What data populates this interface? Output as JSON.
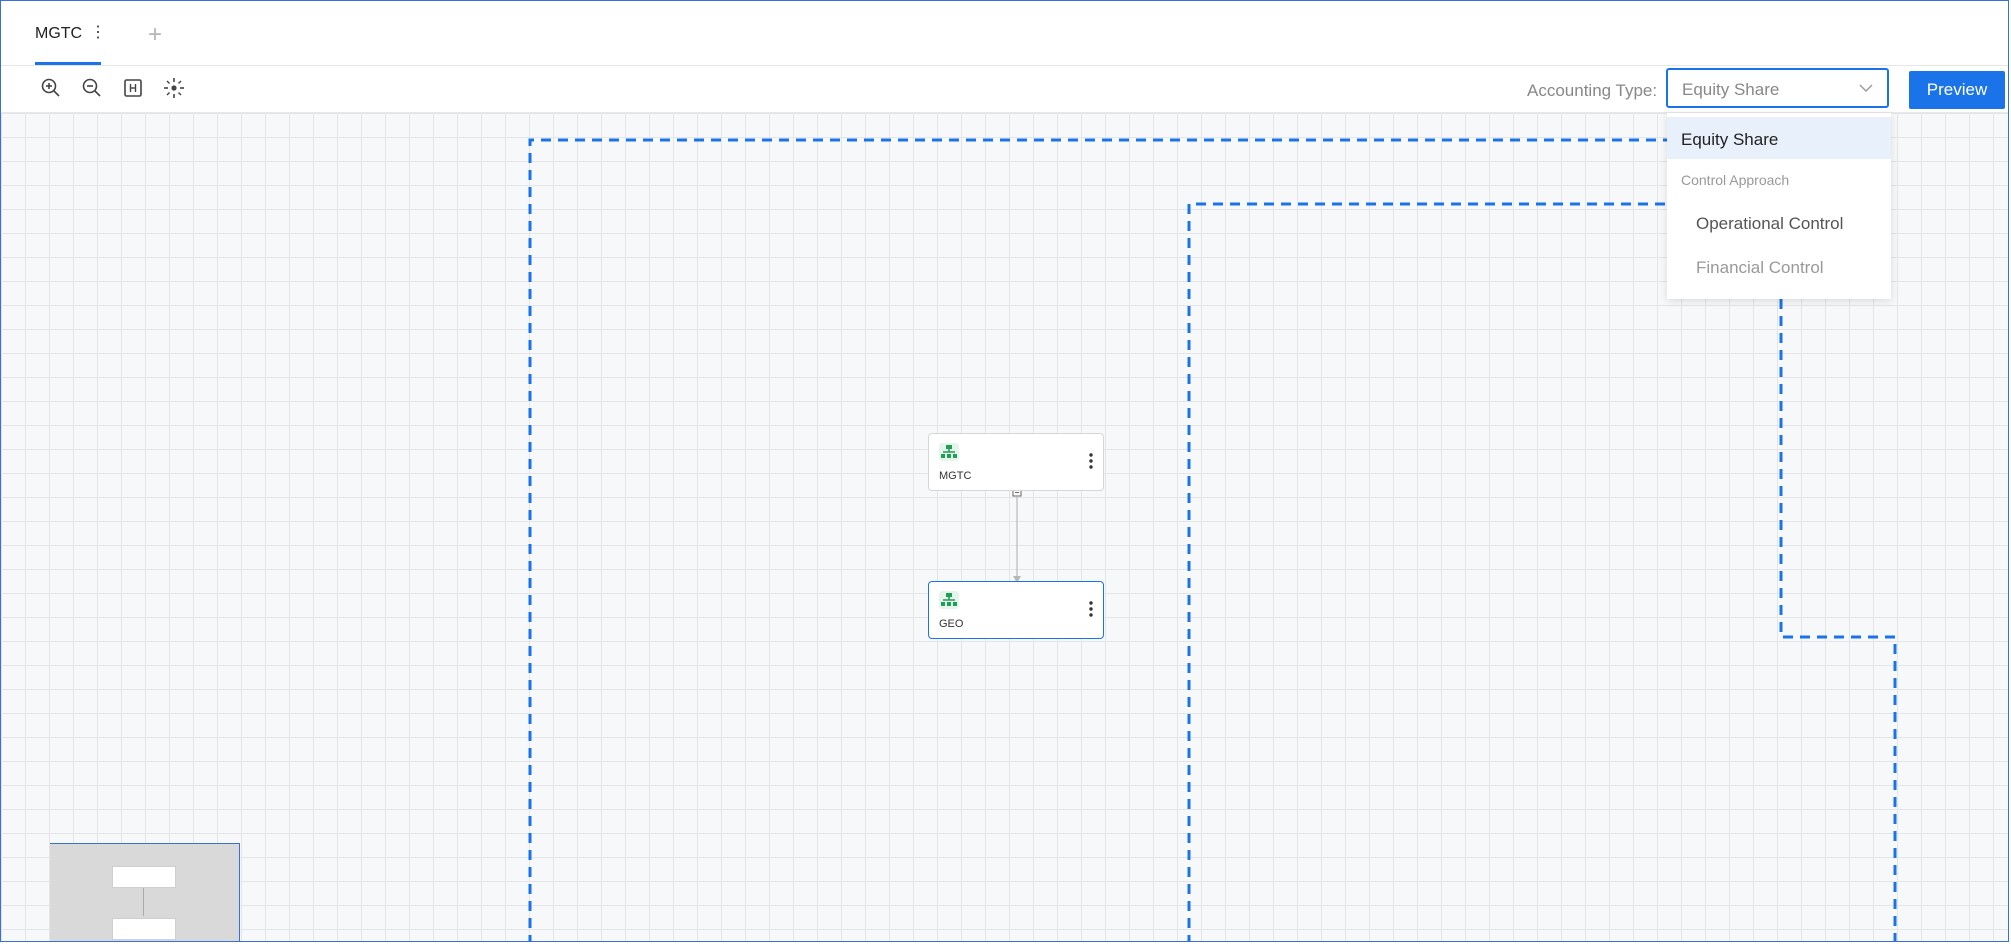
{
  "tabs": [
    {
      "label": "MGTC",
      "menu": "⋮"
    }
  ],
  "add_tab_label": "+",
  "toolbar": {
    "accounting_type_label": "Accounting Type:",
    "accounting_type_value": "Equity Share",
    "preview_label": "Preview",
    "icons": [
      "zoom-in-icon",
      "zoom-out-icon",
      "fit-view-icon",
      "center-focus-icon"
    ]
  },
  "dropdown": {
    "selected": "Equity Share",
    "group_label": "Control Approach",
    "options": [
      "Operational Control",
      "Financial Control"
    ]
  },
  "nodes": [
    {
      "label": "MGTC",
      "icon": "org-chart-icon",
      "menu": "⋮"
    },
    {
      "label": "GEO",
      "icon": "org-chart-icon",
      "menu": "⋮",
      "selected": true
    }
  ],
  "minimap": {
    "nodes": [
      "MGTC",
      "GEO"
    ]
  },
  "colors": {
    "accent": "#1a73e8",
    "node_icon": "#1e9e57"
  }
}
